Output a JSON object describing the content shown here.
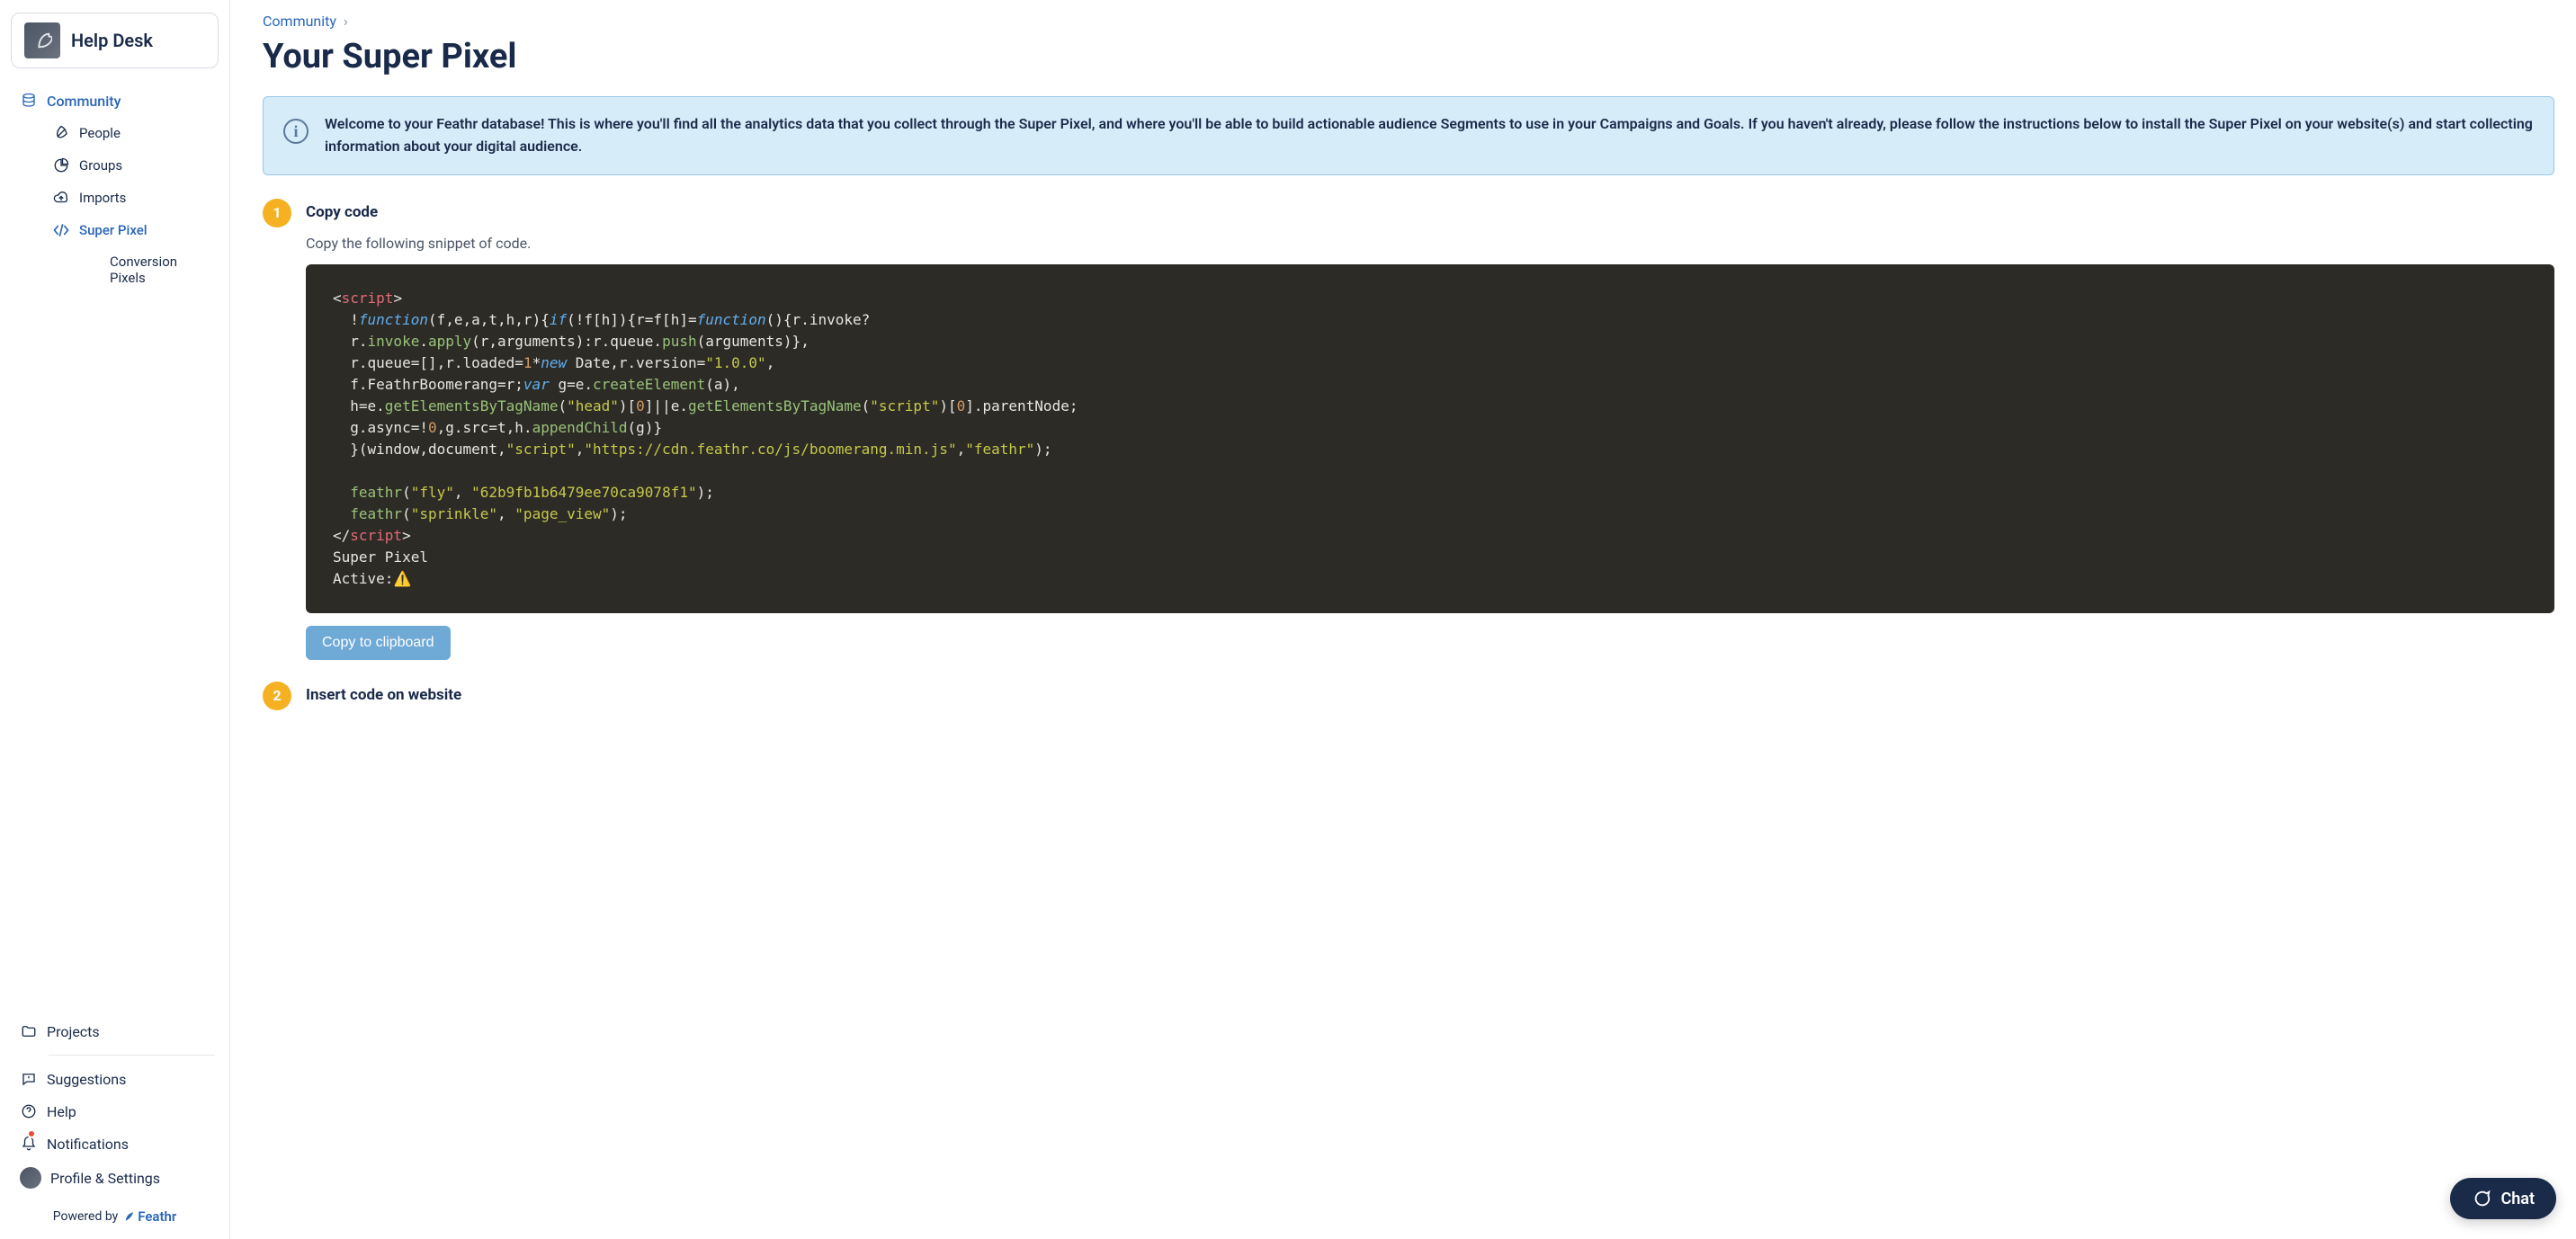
{
  "brand": {
    "title": "Help Desk"
  },
  "sidebar": {
    "community": "Community",
    "people": "People",
    "groups": "Groups",
    "imports": "Imports",
    "super_pixel": "Super Pixel",
    "conversion_pixels": "Conversion Pixels",
    "projects": "Projects",
    "suggestions": "Suggestions",
    "help": "Help",
    "notifications": "Notifications",
    "profile": "Profile & Settings",
    "powered_by": "Powered by",
    "feathr": "Feathr"
  },
  "breadcrumb": {
    "community": "Community",
    "sep": "›"
  },
  "page": {
    "title": "Your Super Pixel"
  },
  "banner": {
    "text": "Welcome to your Feathr database! This is where you'll find all the analytics data that you collect through the Super Pixel, and where you'll be able to build actionable audience Segments to use in your Campaigns and Goals. If you haven't already, please follow the instructions below to install the Super Pixel on your website(s) and start collecting information about your digital audience."
  },
  "steps": {
    "s1": {
      "num": "1",
      "title": "Copy code",
      "desc": "Copy the following snippet of code.",
      "status_label": "Super Pixel",
      "status_active": "Active:",
      "copy_btn": "Copy to clipboard"
    },
    "s2": {
      "num": "2",
      "title": "Insert code on website"
    }
  },
  "chat": {
    "label": "Chat"
  },
  "code_raw": "<script>\n  !function(f,e,a,t,h,r){if(!f[h]){r=f[h]=function(){r.invoke?\n  r.invoke.apply(r,arguments):r.queue.push(arguments)},\n  r.queue=[],r.loaded=1*new Date,r.version=\"1.0.0\",\n  f.FeathrBoomerang=r;var g=e.createElement(a),\n  h=e.getElementsByTagName(\"head\")[0]||e.getElementsByTagName(\"script\")[0].parentNode;\n  g.async=!0,g.src=t,h.appendChild(g)}\n  }(window,document,\"script\",\"https://cdn.feathr.co/js/boomerang.min.js\",\"feathr\");\n\n  feathr(\"fly\", \"62b9fb1b6479ee70ca9078f1\");\n  feathr(\"sprinkle\", \"page_view\");\n</script>\nSuper Pixel\nActive:⚠️"
}
